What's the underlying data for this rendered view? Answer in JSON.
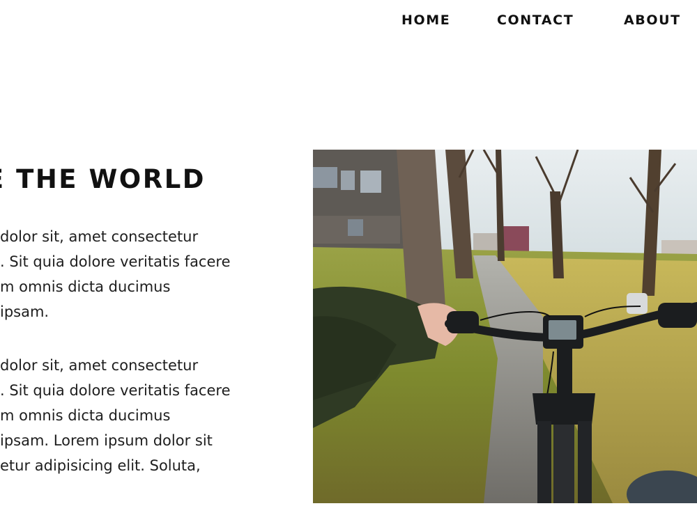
{
  "nav": {
    "items": [
      {
        "label": "HOME"
      },
      {
        "label": "CONTACT"
      },
      {
        "label": "ABOUT"
      }
    ]
  },
  "hero": {
    "title": "E THE WORLD",
    "paragraphs": [
      {
        "lines": [
          "dolor sit, amet consectetur",
          ". Sit quia dolore veritatis facere",
          "m omnis dicta ducimus",
          "ipsam."
        ]
      },
      {
        "lines": [
          "dolor sit, amet consectetur",
          ". Sit quia dolore veritatis facere",
          "m omnis dicta ducimus",
          "ipsam. Lorem ipsum dolor sit",
          "etur adipisicing elit. Soluta,"
        ]
      }
    ]
  },
  "photo": {
    "subject": "bicycle-ride-photo",
    "colors": {
      "sky": "#dfe7ea",
      "grass": "#8f9a3a",
      "path": "#8a8a86",
      "trunk": "#6b5a4a",
      "bike": "#1b1d1f",
      "sleeve": "#2f3a24"
    }
  }
}
